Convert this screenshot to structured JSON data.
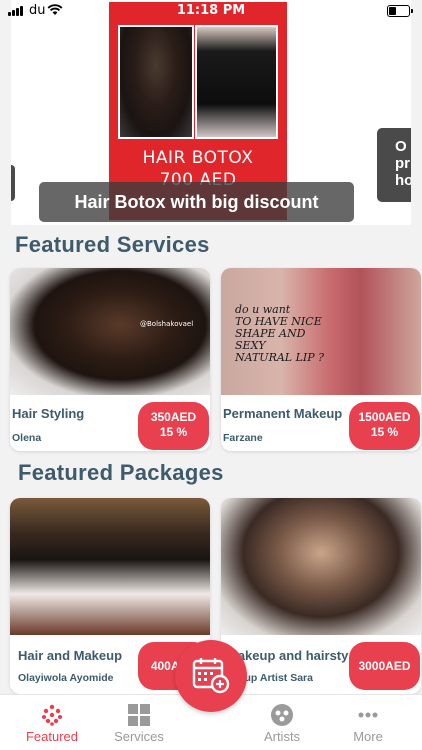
{
  "status_bar": {
    "carrier": "du",
    "time": "11:18 PM"
  },
  "banner": {
    "promo_line1": "HAIR BOTOX",
    "promo_line2": "700 AED",
    "caption": "Hair Botox with big discount",
    "next_slide_text": "O\npr\nho"
  },
  "featured_services": {
    "title": "Featured Services",
    "items": [
      {
        "name": "Hair Styling",
        "artist": "Olena",
        "price": "350AED",
        "discount": "15 %",
        "watermark": "@Bolshakovael"
      },
      {
        "name": "Permanent Makeup",
        "artist": "Farzane",
        "price": "1500AED",
        "discount": "15 %",
        "image_text": "do u want\nTO HAVE NICE\nSHAPE AND SEXY\nNATURAL LIP ?"
      }
    ]
  },
  "featured_packages": {
    "title": "Featured Packages",
    "items": [
      {
        "name": "Hair and Makeup",
        "artist": "Olayiwola Ayomide",
        "price": "400AED"
      },
      {
        "name": "Makeup and hairsty",
        "artist": "akeup Artist Sara",
        "price": "3000AED"
      }
    ]
  },
  "tabbar": {
    "tabs": [
      {
        "label": "Featured",
        "icon": "featured-dots-icon",
        "active": true
      },
      {
        "label": "Services",
        "icon": "grid-icon",
        "active": false
      },
      {
        "label": "Artists",
        "icon": "artists-icon",
        "active": false
      },
      {
        "label": "More",
        "icon": "more-dots-icon",
        "active": false
      }
    ],
    "fab_icon": "calendar-add-icon"
  },
  "colors": {
    "accent": "#e8404e",
    "heading": "#3d5b6b",
    "promo_red": "#e0262b"
  }
}
